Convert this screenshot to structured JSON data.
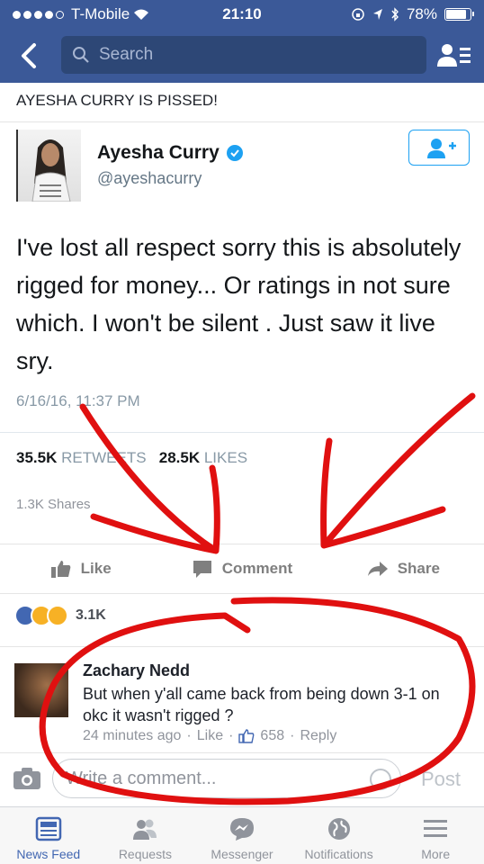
{
  "status": {
    "carrier": "T-Mobile",
    "time": "21:10",
    "battery": "78%",
    "battery_level": 0.78
  },
  "nav": {
    "search_placeholder": "Search"
  },
  "post": {
    "title": "AYESHA CURRY IS PISSED!"
  },
  "tweet": {
    "name": "Ayesha Curry",
    "handle": "@ayeshacurry",
    "text": "I've lost all respect sorry this is absolutely rigged for money... Or ratings in not sure which. I won't be silent . Just saw it live sry.",
    "date": "6/16/16, 11:37 PM",
    "retweets_count": "35.5K",
    "retweets_label": "RETWEETS",
    "likes_count": "28.5K",
    "likes_label": "LIKES"
  },
  "shares": "1.3K Shares",
  "actions": {
    "like": "Like",
    "comment": "Comment",
    "share": "Share"
  },
  "reactions": {
    "count": "3.1K"
  },
  "comment": {
    "name": "Zachary Nedd",
    "text": "But when y'all came back from being down 3-1 on okc it wasn't rigged ?",
    "time": "24 minutes ago",
    "like": "Like",
    "likes": "658",
    "reply": "Reply"
  },
  "composer": {
    "placeholder": "Write a comment...",
    "post": "Post"
  },
  "tabs": [
    {
      "label": "News Feed",
      "icon": "news-feed-icon",
      "active": true
    },
    {
      "label": "Requests",
      "icon": "friends-icon"
    },
    {
      "label": "Messenger",
      "icon": "messenger-icon"
    },
    {
      "label": "Notifications",
      "icon": "globe-icon"
    },
    {
      "label": "More",
      "icon": "menu-icon"
    }
  ],
  "colors": {
    "facebook_blue": "#3b5998",
    "twitter_blue": "#1da1f2",
    "annotation_red": "#e01010"
  }
}
